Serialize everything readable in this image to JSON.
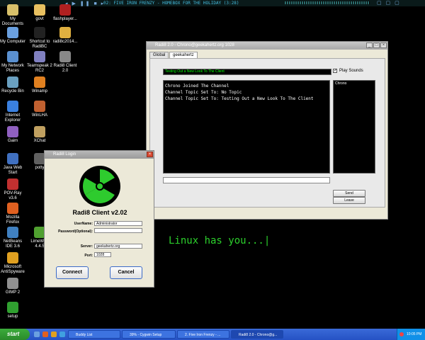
{
  "topbar": {
    "text": "02:  FIVE IRON FRENZY - HOMEBOX FOR THE HOLIDAY (3:28)"
  },
  "desktop_icons": [
    {
      "label": "My Documents",
      "color": "#d8c06a"
    },
    {
      "label": "govt",
      "color": "#e8c060"
    },
    {
      "label": "flashplayer...",
      "color": "#b02020"
    },
    {
      "label": "My Computer",
      "color": "#6aa0e0"
    },
    {
      "label": "Shortcut to RadiBC",
      "color": "#222222"
    },
    {
      "label": "radi8c2014...",
      "color": "#e0b040"
    },
    {
      "label": "My Network Places",
      "color": "#5a90d0"
    },
    {
      "label": "Teamspeak 2 RC2",
      "color": "#8080c0"
    },
    {
      "label": "Radi8 Client 2.0",
      "color": "#888888"
    },
    {
      "label": "Recycle Bin",
      "color": "#6aa0c0"
    },
    {
      "label": "Winamp",
      "color": "#e08020"
    },
    {
      "label": "Internet Explorer",
      "color": "#3a80e0"
    },
    {
      "label": "WinLHA",
      "color": "#c06030"
    },
    {
      "label": "Gaim",
      "color": "#9060c0"
    },
    {
      "label": "XChat",
      "color": "#c0a060"
    },
    {
      "label": "Java Web Start",
      "color": "#4070c0"
    },
    {
      "label": "potty",
      "color": "#606060"
    },
    {
      "label": "POV-Ray v3.6",
      "color": "#c03030"
    },
    {
      "label": "Mozilla Firefox",
      "color": "#e06020"
    },
    {
      "label": "NetBeans IDE 3.6",
      "color": "#4080c0"
    },
    {
      "label": "LimeWire 4.4.5",
      "color": "#50a030"
    },
    {
      "label": "Microsoft AntiSpyware",
      "color": "#e0a020"
    },
    {
      "label": "GIMP 2",
      "color": "#909090"
    },
    {
      "label": "setup",
      "color": "#30a030"
    }
  ],
  "chat_window": {
    "title": "Radi8 2.0 - Chrono@geekahertz.org 1028",
    "tabs": [
      "Global",
      "geekahertz"
    ],
    "topic": "Testing Out a New Look To The Client",
    "play_sounds_label": "Play Sounds",
    "play_sounds_checked": true,
    "messages": [
      "Chrono Joined The Channel",
      "Channel Topic Set To: No Topic",
      "Channel Topic Set To: Testing Out a New Look To The Client"
    ],
    "users": [
      "Chrono"
    ],
    "send_label": "Send",
    "leave_label": "Leave"
  },
  "login_window": {
    "title": "Radi8 Login",
    "heading": "Radi8 Client v2.02",
    "username_label": "UserName:",
    "username_value": "Administrator",
    "password_label": "Password(Optional):",
    "password_value": "",
    "server_label": "Server:",
    "server_value": "geekahertz.org",
    "port_label": "Port:",
    "port_value": "1028",
    "connect_label": "Connect",
    "cancel_label": "Cancel"
  },
  "wallpaper": {
    "text": "Linux has you...|"
  },
  "taskbar": {
    "start_label": "start",
    "tasks": [
      {
        "label": "Buddy List",
        "active": false
      },
      {
        "label": "39% - Cygwin Setup",
        "active": false
      },
      {
        "label": "2. Five Iron Frenzy - ...",
        "active": false
      },
      {
        "label": "Radi8 2.0 - Chrono@g...",
        "active": true
      }
    ],
    "clock": "10:05 PM"
  }
}
